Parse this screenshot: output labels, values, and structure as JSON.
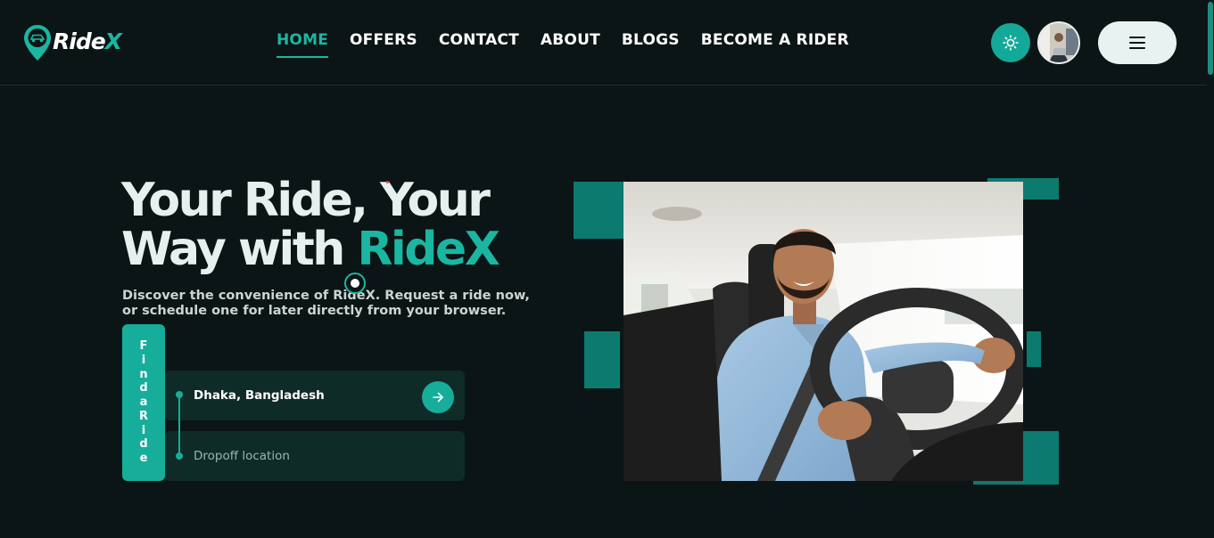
{
  "brand": {
    "name_main": "Ride",
    "name_accent": "X"
  },
  "nav": {
    "items": [
      {
        "label": "HOME",
        "active": true
      },
      {
        "label": "OFFERS",
        "active": false
      },
      {
        "label": "CONTACT",
        "active": false
      },
      {
        "label": "ABOUT",
        "active": false
      },
      {
        "label": "BLOGS",
        "active": false
      },
      {
        "label": "BECOME A RIDER",
        "active": false
      }
    ],
    "theme_icon": "sun-icon",
    "menu_icon": "hamburger-icon"
  },
  "hero": {
    "title_line1": "Your Ride, Your",
    "title_line2_plain": "Way with ",
    "title_line2_accent": "RideX",
    "subtitle": "Discover the convenience of RideX. Request a ride now, or schedule one for later directly from your browser."
  },
  "ride_form": {
    "tab_label": "FindaRide",
    "pickup_value": "Dhaka, Bangladesh",
    "dropoff_placeholder": "Dropoff location"
  },
  "colors": {
    "background": "#0b1515",
    "accent": "#1bb6a2",
    "accent_dark": "#0d7a70",
    "field_bg": "#0f2b28"
  }
}
